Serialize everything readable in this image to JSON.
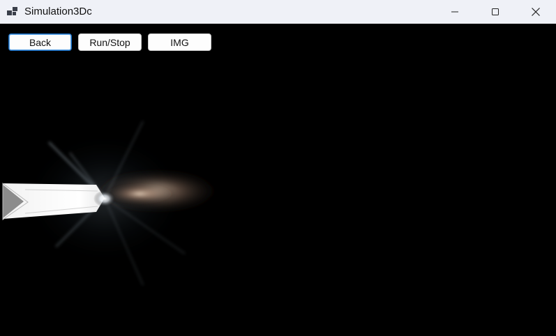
{
  "window": {
    "title": "Simulation3Dc",
    "controls": {
      "minimize_icon": "minimize-icon",
      "maximize_icon": "maximize-icon",
      "close_icon": "close-icon"
    }
  },
  "toolbar": {
    "back_label": "Back",
    "run_stop_label": "Run/Stop",
    "img_label": "IMG"
  },
  "colors": {
    "titlebar_bg": "#eff1f7",
    "canvas_bg": "#000000",
    "focus_border": "#1c6fc4"
  }
}
